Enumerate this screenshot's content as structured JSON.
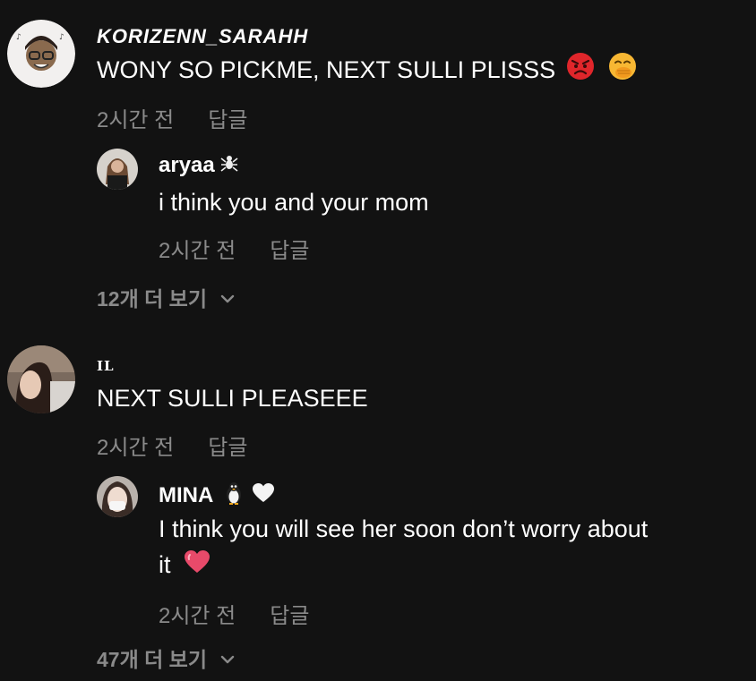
{
  "comments": [
    {
      "username": "KORIZENN_SARAHH",
      "text": "WONY SO PICKME, NEXT SULLI PLISSS",
      "emojis": [
        "angry-face-icon",
        "face-with-hand-over-mouth-icon"
      ],
      "time": "2시간 전",
      "reply_label": "답글",
      "replies": [
        {
          "username": "aryaa",
          "username_emoji": "spider-icon",
          "text": "i think you and your mom",
          "time": "2시간 전",
          "reply_label": "답글"
        }
      ],
      "more_replies": "12개 더 보기"
    },
    {
      "username": "IL",
      "text": "NEXT SULLI PLEASEEE",
      "time": "2시간 전",
      "reply_label": "답글",
      "replies": [
        {
          "username": "MINA",
          "username_emojis": [
            "penguin-icon",
            "white-heart-icon"
          ],
          "text_line1": "I think you will see her soon don’t worry about",
          "text_line2": "it",
          "text_emoji": "red-heart-icon",
          "time": "2시간 전",
          "reply_label": "답글"
        }
      ],
      "more_replies": "47개 더 보기"
    }
  ],
  "colors": {
    "background": "#121212",
    "primary_text": "#ffffff",
    "secondary_text": "#8a8a8a"
  }
}
